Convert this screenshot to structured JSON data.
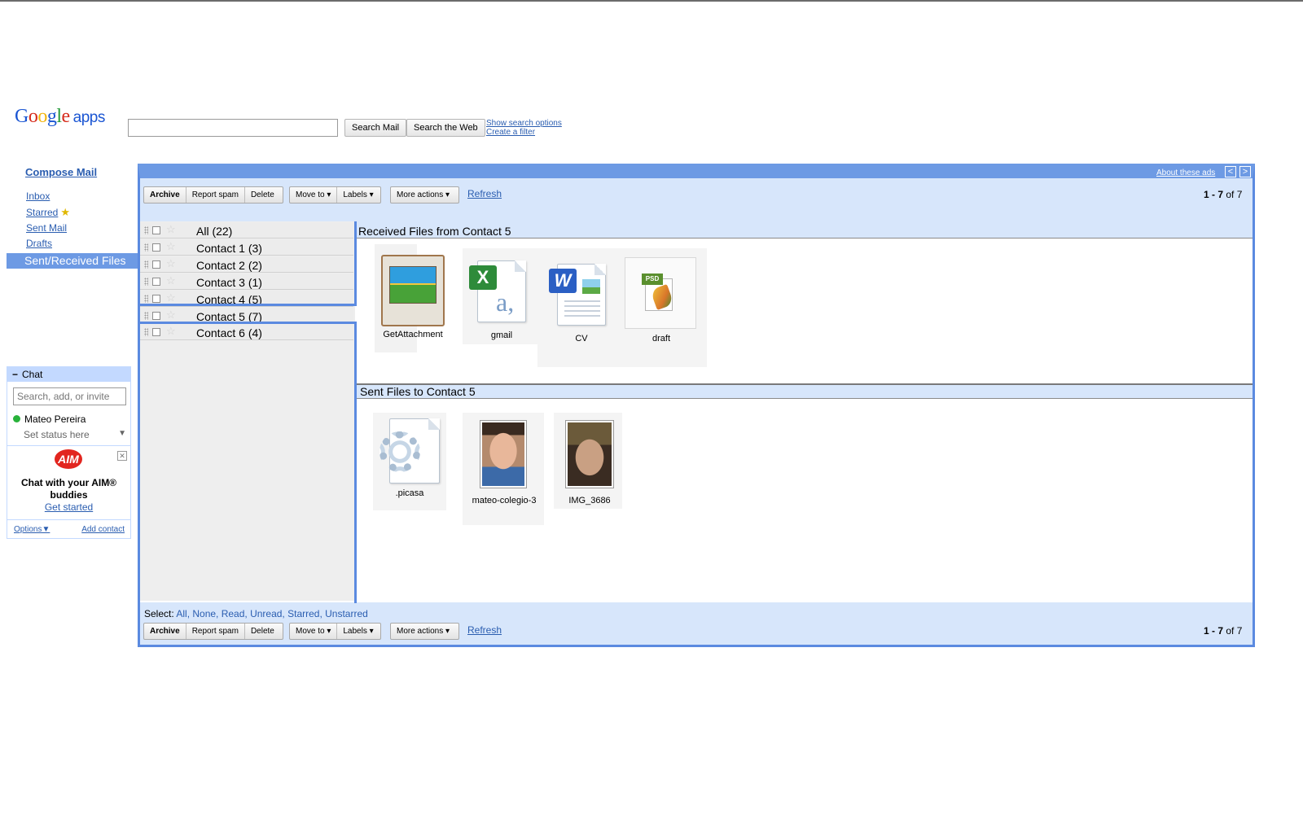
{
  "header": {
    "logo": {
      "g1": "G",
      "o1": "o",
      "o2": "o",
      "g2": "g",
      "l": "l",
      "e": "e",
      "apps": "apps"
    },
    "search_placeholder": "",
    "search_mail_label": "Search Mail",
    "search_web_label": "Search the Web",
    "show_search_options": "Show search options",
    "create_filter": "Create a filter"
  },
  "nav": {
    "compose": "Compose Mail",
    "inbox": "Inbox",
    "starred": "Starred",
    "sent": "Sent Mail",
    "drafts": "Drafts",
    "selected": "Sent/Received Files",
    "star_icon": "★"
  },
  "chat": {
    "title": "Chat",
    "minus": "−",
    "search_placeholder": "Search, add, or invite",
    "user": "Mateo Pereira",
    "status": "Set status here",
    "status_arrow": "▼",
    "aim_logo": "AIM",
    "aim_close": "✕",
    "aim_text": "Chat with your AIM® buddies",
    "aim_link": "Get started",
    "options": "Options▼",
    "add_contact": "Add contact"
  },
  "ads_bar": {
    "about_ads": "About these ads",
    "prev": "<",
    "next": ">"
  },
  "toolbar": {
    "archive": "Archive",
    "report_spam": "Report spam",
    "delete": "Delete",
    "move_to": "Move to ▾",
    "labels": "Labels ▾",
    "more_actions": "More actions ▾",
    "refresh": "Refresh",
    "count_range": "1 - 7",
    "count_of": "of 7"
  },
  "select_line": {
    "label": "Select:",
    "options": "All, None, Read, Unread, Starred, Unstarred"
  },
  "contacts": [
    {
      "label": "All (22)"
    },
    {
      "label": "Contact 1 (3)"
    },
    {
      "label": "Contact 2 (2)"
    },
    {
      "label": "Contact 3 (1)"
    },
    {
      "label": "Contact 4 (5)"
    },
    {
      "label": "Contact 5 (7)"
    },
    {
      "label": "Contact 6 (4)"
    }
  ],
  "received": {
    "title": "Received Files from Contact 5",
    "files": [
      "GetAttachment",
      "gmail",
      "CV",
      "draft"
    ],
    "badges": {
      "excel": "X",
      "excel_letter": "a,",
      "word": "W",
      "psd": "PSD"
    }
  },
  "sent": {
    "title": "Sent Files to Contact 5",
    "files": [
      ".picasa",
      "mateo-colegio-3",
      "IMG_3686"
    ]
  },
  "colors": {
    "frame_blue": "#5b8ae0",
    "header_blue": "#6d9ae4",
    "toolbar_bg": "#d7e6fb",
    "link_blue": "#2a5db0"
  }
}
